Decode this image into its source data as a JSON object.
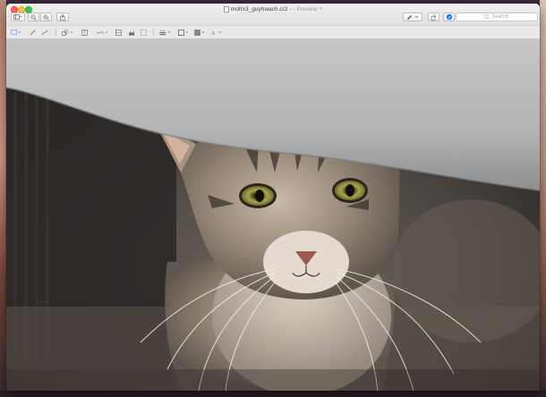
{
  "window": {
    "title": "mofrx3_guyhwach.cr2",
    "app_name": "Preview",
    "title_suffix": "— Preview ˅"
  },
  "toolbar": {
    "sidebar_button": "sidebar-toggle",
    "zoom_out": "zoom-out",
    "zoom_in": "zoom-in",
    "share": "share",
    "markup_pen": "markup-pen",
    "rotate": "rotate",
    "annotate": "annotate"
  },
  "search": {
    "placeholder": "Search"
  },
  "markup_tools": [
    "rect-selection",
    "instant-alpha",
    "sketch",
    "shapes",
    "text",
    "sign",
    "adjust-color",
    "adjust-size",
    "shape-style",
    "border-color",
    "fill-color",
    "text-style"
  ],
  "image": {
    "subject": "tabby cat under a car bumper"
  },
  "colors": {
    "close": "#fc605c",
    "minimize": "#fdbc40",
    "maximize": "#34c84a",
    "active_button": "#1e7cf2"
  }
}
